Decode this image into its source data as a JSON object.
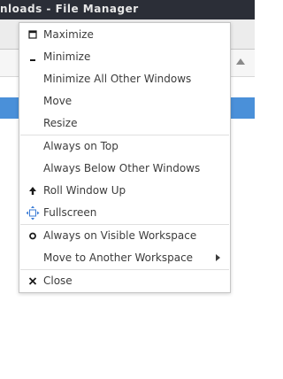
{
  "window": {
    "title": "nloads - File Manager"
  },
  "menu": {
    "items": [
      {
        "label": "Maximize",
        "icon": "maximize-icon"
      },
      {
        "label": "Minimize",
        "icon": "minimize-icon"
      },
      {
        "label": "Minimize All Other Windows",
        "icon": ""
      },
      {
        "label": "Move",
        "icon": ""
      },
      {
        "label": "Resize",
        "icon": ""
      },
      {
        "label": "Always on Top",
        "icon": ""
      },
      {
        "label": "Always Below Other Windows",
        "icon": ""
      },
      {
        "label": "Roll Window Up",
        "icon": "arrow-up-icon"
      },
      {
        "label": "Fullscreen",
        "icon": "fullscreen-icon"
      },
      {
        "label": "Always on Visible Workspace",
        "icon": "circle-icon"
      },
      {
        "label": "Move to Another Workspace",
        "icon": "submenu-arrow-icon"
      },
      {
        "label": "Close",
        "icon": "close-icon"
      }
    ]
  },
  "colors": {
    "titlebar": "#2b2e37",
    "selection": "#4a90d9",
    "menu_text": "#3c3c3c"
  }
}
